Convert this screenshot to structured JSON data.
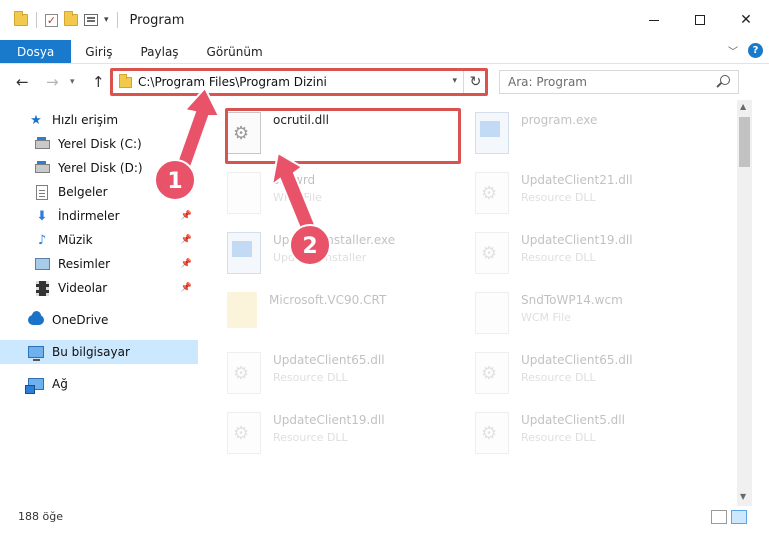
{
  "window": {
    "title": "Program",
    "quick_access_caret": "▾",
    "minimize_label": "",
    "maximize_label": "",
    "close_label": "✕"
  },
  "ribbon": {
    "tabs": [
      "Dosya",
      "Giriş",
      "Paylaş",
      "Görünüm"
    ],
    "help_label": "?"
  },
  "address": {
    "path": "C:\\Program Files\\Program Dizini",
    "search_placeholder": "Ara: Program"
  },
  "sidebar": {
    "items": [
      {
        "label": "Hızlı erişim",
        "icon": "star-icon",
        "pinned": false
      },
      {
        "label": "Yerel Disk (C:)",
        "icon": "drive-icon",
        "pinned": true
      },
      {
        "label": "Yerel Disk (D:)",
        "icon": "drive-icon",
        "pinned": true
      },
      {
        "label": "Belgeler",
        "icon": "document-icon",
        "pinned": true
      },
      {
        "label": "İndirmeler",
        "icon": "download-icon",
        "pinned": true
      },
      {
        "label": "Müzik",
        "icon": "music-icon",
        "pinned": true
      },
      {
        "label": "Resimler",
        "icon": "pictures-icon",
        "pinned": true
      },
      {
        "label": "Videolar",
        "icon": "video-icon",
        "pinned": true
      },
      {
        "label": "OneDrive",
        "icon": "cloud-icon",
        "pinned": false
      },
      {
        "label": "Bu bilgisayar",
        "icon": "computer-icon",
        "pinned": false,
        "selected": true
      },
      {
        "label": "Ağ",
        "icon": "network-icon",
        "pinned": false
      }
    ]
  },
  "files": [
    {
      "name": "ocrutil.dll",
      "type": "",
      "icon": "dll-icon",
      "highlighted": true
    },
    {
      "name": "program.exe",
      "type": "",
      "icon": "exe-icon"
    },
    {
      "name": "sic.wrd",
      "type": "WRD File",
      "icon": "file-icon"
    },
    {
      "name": "UpdateClient21.dll",
      "type": "Resource DLL",
      "icon": "dll-icon"
    },
    {
      "name": "UpdatesInstaller.exe",
      "type": "Updates installer",
      "icon": "exe-icon"
    },
    {
      "name": "UpdateClient19.dll",
      "type": "Resource DLL",
      "icon": "dll-icon"
    },
    {
      "name": "Microsoft.VC90.CRT",
      "type": "",
      "icon": "folder-icon"
    },
    {
      "name": "SndToWP14.wcm",
      "type": "WCM File",
      "icon": "file-icon"
    },
    {
      "name": "UpdateClient65.dll",
      "type": "Resource DLL",
      "icon": "dll-icon"
    },
    {
      "name": "UpdateClient65.dll",
      "type": "Resource DLL",
      "icon": "dll-icon"
    },
    {
      "name": "UpdateClient19.dll",
      "type": "Resource DLL",
      "icon": "dll-icon"
    },
    {
      "name": "UpdateClient5.dll",
      "type": "Resource DLL",
      "icon": "dll-icon"
    }
  ],
  "status": {
    "item_count": "188 öğe"
  },
  "callouts": [
    {
      "number": "1"
    },
    {
      "number": "2"
    }
  ],
  "colors": {
    "accent": "#1979ca",
    "highlight_box": "#d9534f",
    "selection": "#cce8ff",
    "callout_arrow": "#e8536a"
  }
}
